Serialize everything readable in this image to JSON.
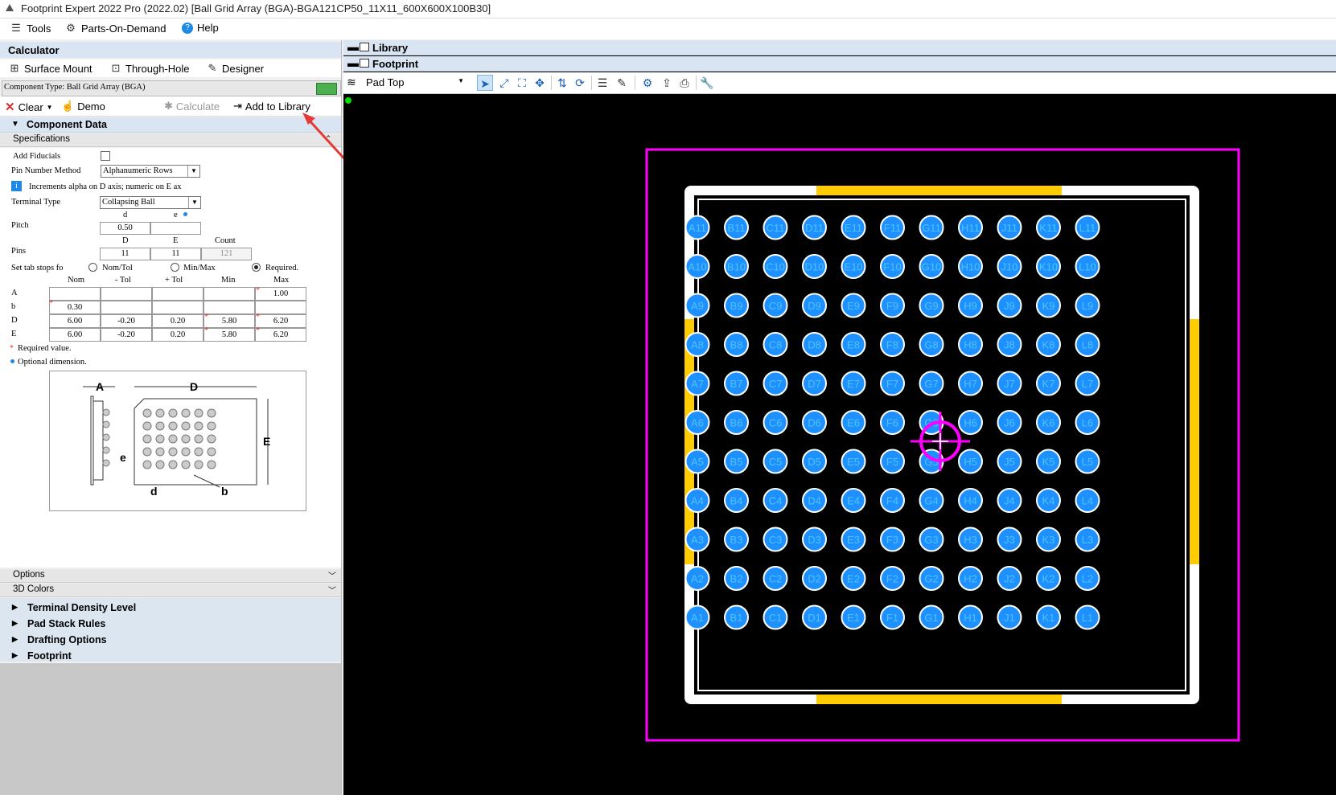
{
  "window": {
    "title": "Footprint Expert 2022 Pro (2022.02) [Ball Grid Array (BGA)-BGA121CP50_11X11_600X600X100B30]"
  },
  "menu": {
    "tools": "Tools",
    "parts": "Parts-On-Demand",
    "help": "Help"
  },
  "calculator": {
    "title": "Calculator",
    "modes": {
      "surface": "Surface Mount",
      "through": "Through-Hole",
      "designer": "Designer"
    },
    "component_type": "Component Type: Ball Grid Array (BGA)",
    "actions": {
      "clear": "Clear",
      "demo": "Demo",
      "calculate": "Calculate",
      "add": "Add to Library"
    },
    "component_data": "Component Data",
    "specifications": "Specifications",
    "add_fiducials": "Add Fiducials",
    "pin_number_method": "Pin Number Method",
    "pin_number_value": "Alphanumeric Rows",
    "increments_note": "Increments alpha on D axis; numeric on E ax",
    "terminal_type": "Terminal Type",
    "terminal_value": "Collapsing Ball",
    "pitch_label": "Pitch",
    "pitch_hdr_d": "d",
    "pitch_hdr_e": "e",
    "pitch_d": "0.50",
    "pitch_e": "",
    "pins_label": "Pins",
    "pins_hdr_D": "D",
    "pins_hdr_E": "E",
    "pins_hdr_count": "Count",
    "pins_D": "11",
    "pins_E": "11",
    "pins_count": "121",
    "tabstops_label": "Set tab stops fo",
    "tabstop_opts": [
      "Nom/Tol",
      "Min/Max",
      "Required."
    ],
    "table_headers": [
      "Nom",
      "- Tol",
      "+ Tol",
      "Min",
      "Max"
    ],
    "table_rows": [
      {
        "label": "A",
        "cells": [
          "",
          "",
          "",
          "",
          "1.00"
        ]
      },
      {
        "label": "b",
        "cells": [
          "0.30",
          "",
          "",
          "",
          ""
        ]
      },
      {
        "label": "D",
        "cells": [
          "6.00",
          "-0.20",
          "0.20",
          "5.80",
          "6.20"
        ]
      },
      {
        "label": "E",
        "cells": [
          "6.00",
          "-0.20",
          "0.20",
          "5.80",
          "6.20"
        ]
      }
    ],
    "required_note": "Required value.",
    "optional_note": "Optional dimension.",
    "diagram_labels": {
      "A": "A",
      "D": "D",
      "E": "E",
      "e": "e",
      "d": "d",
      "b": "b"
    },
    "options": "Options",
    "colors3d": "3D Colors",
    "tree": [
      "Terminal Density Level",
      "Pad Stack Rules",
      "Drafting Options",
      "Footprint"
    ]
  },
  "right": {
    "library": "Library",
    "footprint": "Footprint",
    "layer": "Pad Top"
  },
  "board": {
    "rows": [
      "11",
      "10",
      "9",
      "8",
      "7",
      "6",
      "5",
      "4",
      "3",
      "2",
      "1"
    ],
    "cols": [
      "A",
      "B",
      "C",
      "D",
      "E",
      "F",
      "G",
      "H",
      "J",
      "K",
      "L"
    ],
    "colors": {
      "pad": "#1e90ff",
      "courtyard": "#ff00ff",
      "silk": "#ffffff",
      "assembly": "#ffcc00",
      "background": "#000000"
    }
  }
}
